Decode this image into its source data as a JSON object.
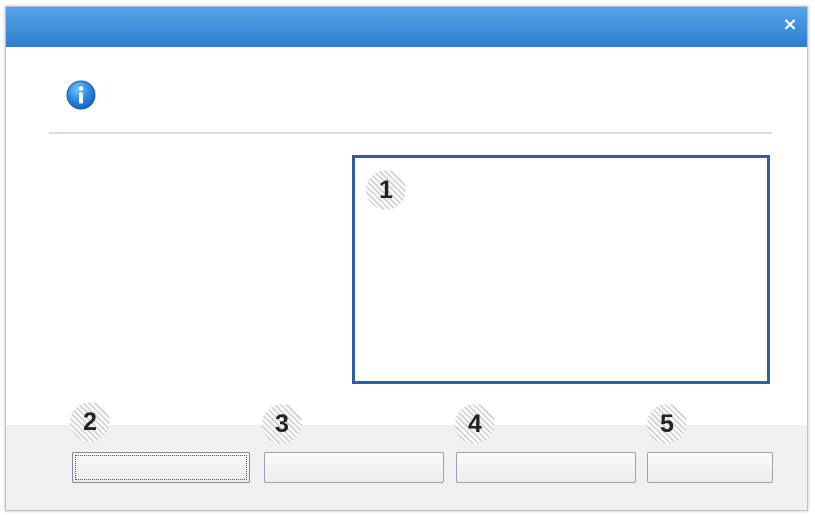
{
  "dialog": {
    "title": "",
    "close_glyph": "×",
    "icon": "info-icon",
    "accent_color": "#3f8fda",
    "highlight_color": "#2e5fa6"
  },
  "message_area": {
    "callout": "1"
  },
  "buttons": [
    {
      "callout": "2",
      "label": ""
    },
    {
      "callout": "3",
      "label": ""
    },
    {
      "callout": "4",
      "label": ""
    },
    {
      "callout": "5",
      "label": ""
    }
  ]
}
